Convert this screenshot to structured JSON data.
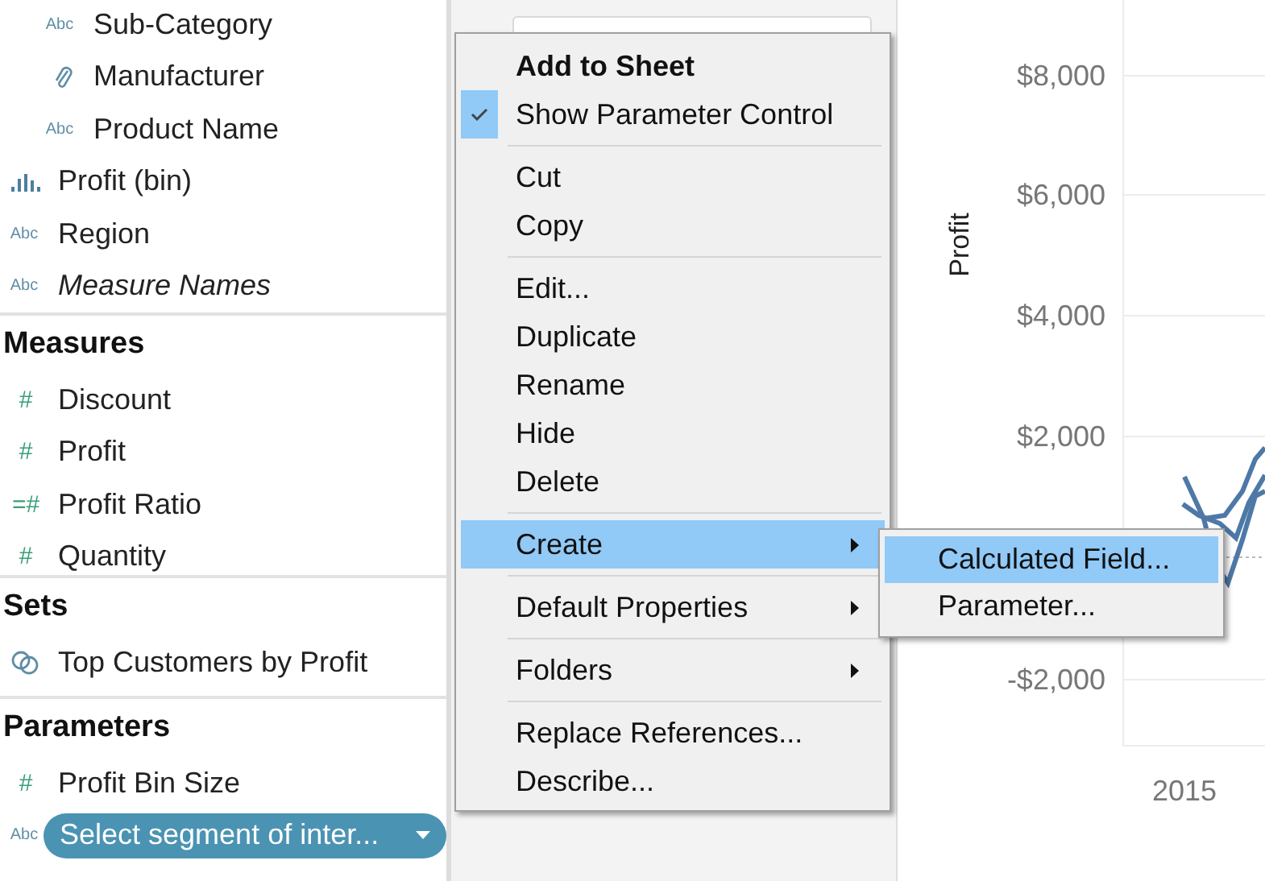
{
  "data_pane": {
    "sections": [
      {
        "items": [
          {
            "kind": "hierarchy",
            "children": [
              {
                "label": "Sub-Category",
                "kind": "text",
                "icon": "Abc",
                "italic": false
              },
              {
                "label": "Manufacturer",
                "kind": "group",
                "italic": false
              },
              {
                "label": "Product Name",
                "kind": "text",
                "icon": "Abc",
                "italic": false
              }
            ]
          },
          {
            "label": "Profit (bin)",
            "kind": "bin",
            "italic": false
          },
          {
            "label": "Region",
            "kind": "text",
            "icon": "Abc",
            "italic": false
          },
          {
            "label": "Measure Names",
            "kind": "text",
            "icon": "Abc",
            "italic": true
          }
        ]
      },
      {
        "title": "Measures",
        "items": [
          {
            "label": "Discount",
            "kind": "number",
            "icon": "#",
            "italic": false
          },
          {
            "label": "Profit",
            "kind": "number",
            "icon": "#",
            "italic": false
          },
          {
            "label": "Profit Ratio",
            "kind": "calc",
            "icon": "=#",
            "italic": false
          },
          {
            "label": "Quantity",
            "kind": "number",
            "icon": "#",
            "italic": false
          }
        ]
      },
      {
        "title": "Sets",
        "items": [
          {
            "label": "Top Customers by Profit",
            "kind": "set",
            "italic": false
          }
        ]
      },
      {
        "title": "Parameters",
        "items": [
          {
            "label": "Profit Bin Size",
            "kind": "number",
            "icon": "#",
            "italic": false,
            "selected": false
          },
          {
            "label": "Select segment of inter...",
            "kind": "text",
            "icon": "Abc",
            "italic": false,
            "selected": true
          }
        ]
      }
    ]
  },
  "context_menu": {
    "sections": [
      [
        {
          "label": "Add to Sheet",
          "kind": "default",
          "checked": false,
          "highlighted": false
        },
        {
          "label": "Show Parameter Control",
          "kind": "item",
          "checked": true,
          "highlighted": false
        }
      ],
      [
        {
          "label": "Cut",
          "kind": "item",
          "checked": false,
          "highlighted": false
        },
        {
          "label": "Copy",
          "kind": "item",
          "checked": false,
          "highlighted": false
        }
      ],
      [
        {
          "label": "Edit...",
          "kind": "item",
          "checked": false,
          "highlighted": false
        },
        {
          "label": "Duplicate",
          "kind": "item",
          "checked": false,
          "highlighted": false
        },
        {
          "label": "Rename",
          "kind": "item",
          "checked": false,
          "highlighted": false
        },
        {
          "label": "Hide",
          "kind": "item",
          "checked": false,
          "highlighted": false
        },
        {
          "label": "Delete",
          "kind": "item",
          "checked": false,
          "highlighted": false
        }
      ],
      [
        {
          "label": "Create",
          "kind": "submenu",
          "checked": false,
          "highlighted": true
        }
      ],
      [
        {
          "label": "Default Properties",
          "kind": "submenu",
          "checked": false,
          "highlighted": false
        }
      ],
      [
        {
          "label": "Folders",
          "kind": "submenu",
          "checked": false,
          "highlighted": false
        }
      ],
      [
        {
          "label": "Replace References...",
          "kind": "item",
          "checked": false,
          "highlighted": false
        },
        {
          "label": "Describe...",
          "kind": "item",
          "checked": false,
          "highlighted": false
        }
      ]
    ],
    "submenu": [
      {
        "label": "Calculated Field...",
        "highlighted": true
      },
      {
        "label": "Parameter...",
        "highlighted": false
      }
    ]
  },
  "chart": {
    "axis_title": "Profit",
    "y_tick_labels": [
      "$8,000",
      "$6,000",
      "$4,000",
      "$2,000",
      "-$2,000"
    ],
    "x_tick_label": "2015"
  }
}
